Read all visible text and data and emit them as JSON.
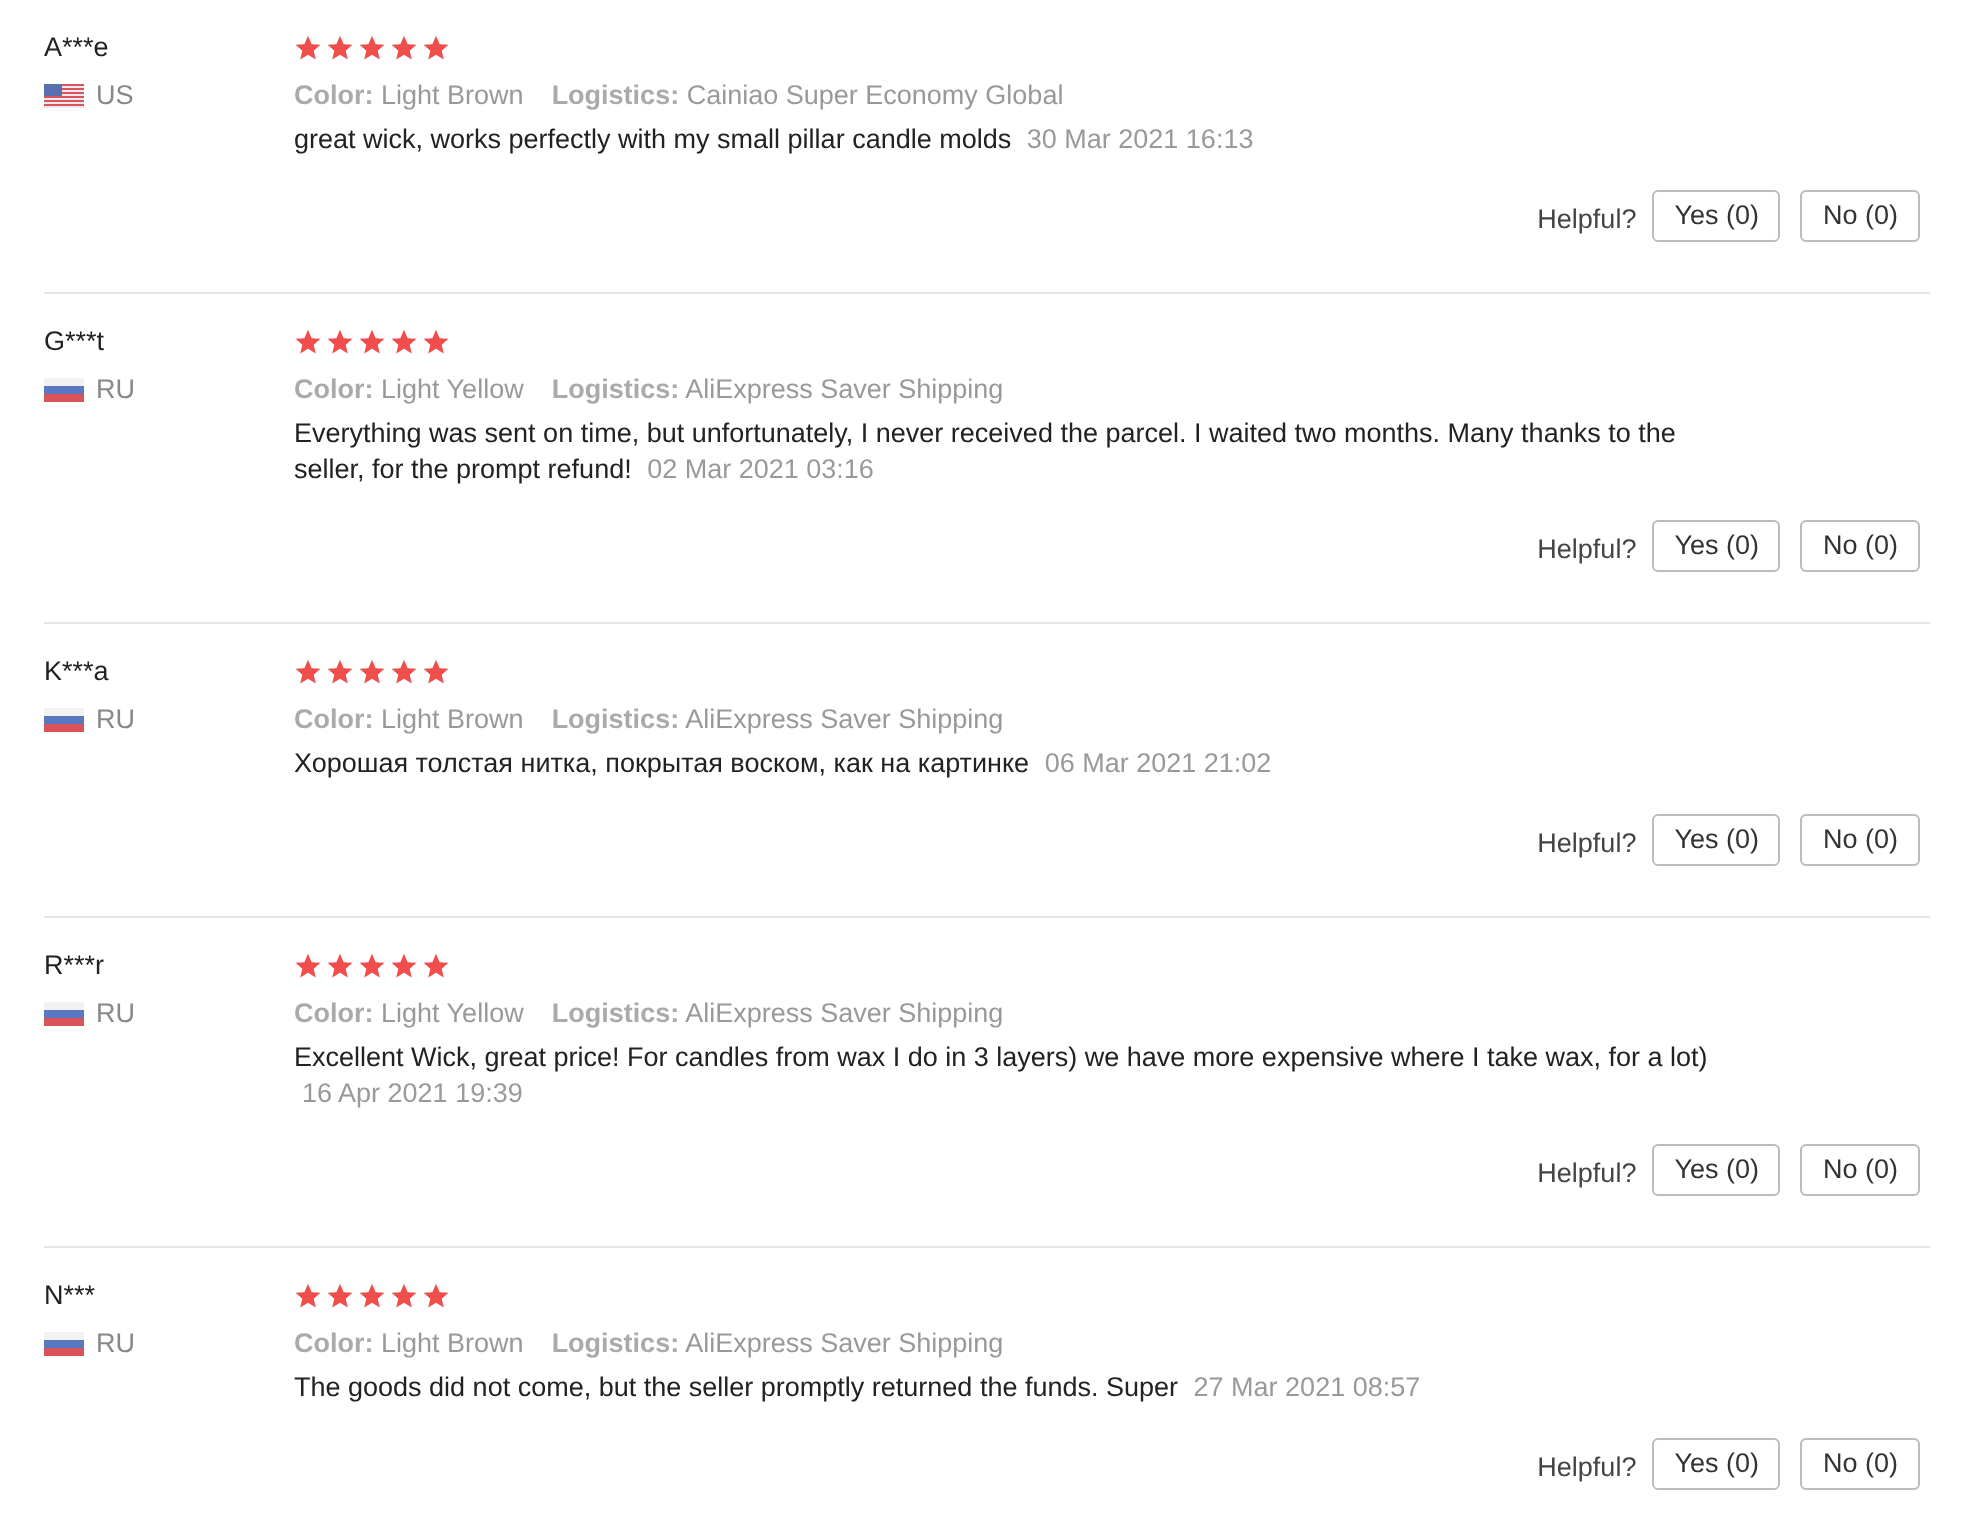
{
  "reviews": [
    {
      "name": "A***e",
      "kind": "us",
      "country": "US",
      "stars": 5,
      "color_label": "Color:",
      "color_value": "Light Brown",
      "logistics_label": "Logistics:",
      "logistics": "Cainiao Super Economy Global",
      "text": "great wick, works perfectly with my small pillar candle molds",
      "date": "30 Mar 2021 16:13",
      "helpful_label": "Helpful?",
      "yes": "Yes (0)",
      "no": "No (0)"
    },
    {
      "name": "G***t",
      "kind": "ru",
      "country": "RU",
      "stars": 5,
      "color_label": "Color:",
      "color_value": "Light Yellow",
      "logistics_label": "Logistics:",
      "logistics": "AliExpress Saver Shipping",
      "text": "Everything was sent on time, but unfortunately, I never received the parcel. I waited two months. Many thanks to the seller, for the prompt refund!",
      "date": "02 Mar 2021 03:16",
      "helpful_label": "Helpful?",
      "yes": "Yes (0)",
      "no": "No (0)"
    },
    {
      "name": "K***a",
      "kind": "ru",
      "country": "RU",
      "stars": 5,
      "color_label": "Color:",
      "color_value": "Light Brown",
      "logistics_label": "Logistics:",
      "logistics": "AliExpress Saver Shipping",
      "text": "Хорошая толстая нитка, покрытая воском, как на картинке",
      "date": "06 Mar 2021 21:02",
      "helpful_label": "Helpful?",
      "yes": "Yes (0)",
      "no": "No (0)"
    },
    {
      "name": "R***r",
      "kind": "ru",
      "country": "RU",
      "stars": 5,
      "color_label": "Color:",
      "color_value": "Light Yellow",
      "logistics_label": "Logistics:",
      "logistics": "AliExpress Saver Shipping",
      "text": "Excellent Wick, great price! For candles from wax I do in 3 layers) we have more expensive where I take wax, for a lot)",
      "date": "16 Apr 2021 19:39",
      "helpful_label": "Helpful?",
      "yes": "Yes (0)",
      "no": "No (0)"
    },
    {
      "name": "N***",
      "kind": "ru",
      "country": "RU",
      "stars": 5,
      "color_label": "Color:",
      "color_value": "Light Brown",
      "logistics_label": "Logistics:",
      "logistics": "AliExpress Saver Shipping",
      "text": "The goods did not come, but the seller promptly returned the funds. Super",
      "date": "27 Mar 2021 08:57",
      "helpful_label": "Helpful?",
      "yes": "Yes (0)",
      "no": "No (0)"
    }
  ]
}
